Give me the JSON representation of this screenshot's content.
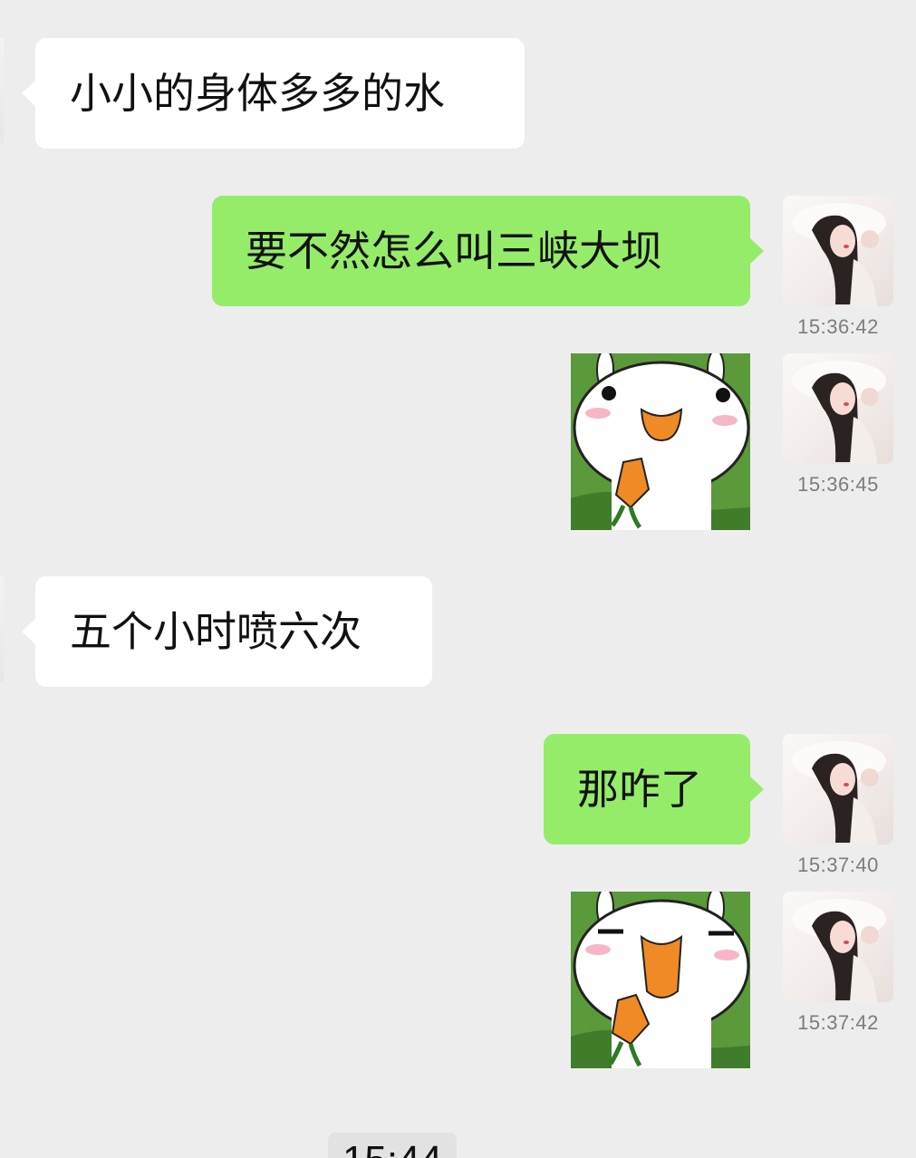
{
  "messages": [
    {
      "side": "in",
      "type": "text",
      "text": "小小的身体多多的水"
    },
    {
      "side": "out",
      "type": "text",
      "text": "要不然怎么叫三峡大坝",
      "time": "15:36:42"
    },
    {
      "side": "out",
      "type": "sticker",
      "sticker": "rabbit-eating-carrot",
      "time": "15:36:45"
    },
    {
      "side": "in",
      "type": "text",
      "text": "五个小时喷六次"
    },
    {
      "side": "out",
      "type": "text",
      "text": "那咋了",
      "time": "15:37:40"
    },
    {
      "side": "out",
      "type": "sticker",
      "sticker": "rabbit-eating-carrot-squint",
      "time": "15:37:42"
    }
  ],
  "system_time": "15:44",
  "colors": {
    "background": "#ededed",
    "incoming_bubble": "#ffffff",
    "outgoing_bubble": "#95ec69",
    "timestamp": "#7c7c7c"
  }
}
